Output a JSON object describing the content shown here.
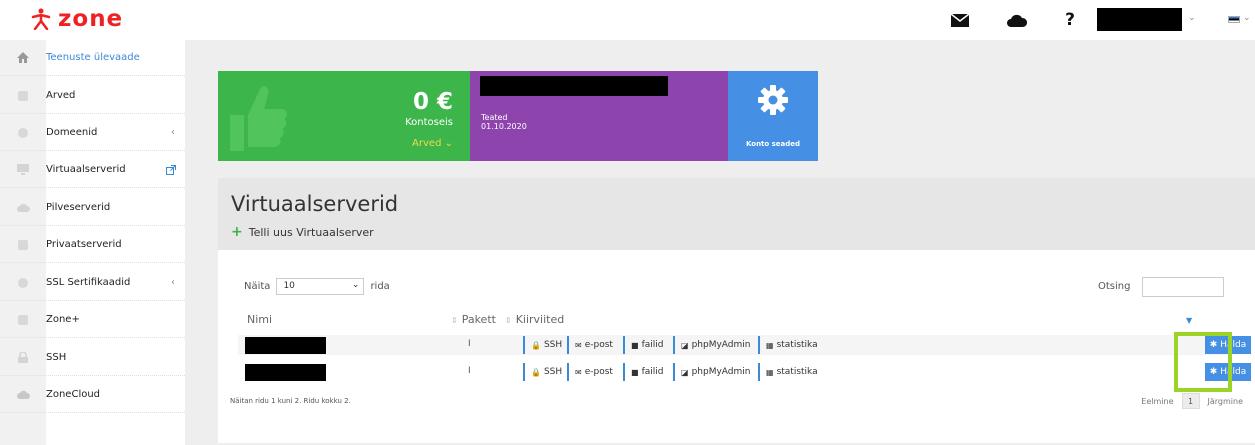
{
  "header": {
    "logo_text": "zone",
    "help_glyph": "?",
    "icons": [
      "envelope-icon",
      "cloud-icon",
      "help-icon",
      "chevron-down-icon",
      "flag-icon"
    ]
  },
  "sidebar": {
    "items": [
      {
        "label": "Teenuste ülevaade",
        "icon": "home-icon"
      },
      {
        "label": "Arved",
        "icon": "invoice-icon"
      },
      {
        "label": "Domeenid",
        "icon": "globe-icon",
        "chevron": "‹"
      },
      {
        "label": "Virtuaalserverid",
        "icon": "monitor-icon"
      },
      {
        "label": "Pilveserverid",
        "icon": "cloud-icon"
      },
      {
        "label": "Privaatserverid",
        "icon": "database-icon"
      },
      {
        "label": "SSL Sertifikaadid",
        "icon": "certificate-icon",
        "chevron": "‹"
      },
      {
        "label": "Zone+",
        "icon": "plus-square-icon"
      },
      {
        "label": "SSH",
        "icon": "lock-icon"
      },
      {
        "label": "ZoneCloud",
        "icon": "cloud-upload-icon"
      }
    ]
  },
  "tiles": {
    "balance_amount": "0 €",
    "balance_label": "Kontoseis",
    "invoices_link": "Arved",
    "notices_label": "Teated",
    "notices_date": "01.10.2020",
    "settings_label": "Konto seaded"
  },
  "page": {
    "title": "Virtuaalserverid",
    "order_link": "Telli uus Virtuaalserver"
  },
  "table": {
    "show_prefix": "Näita",
    "page_size": "10",
    "show_suffix": "rida",
    "search_label": "Otsing",
    "columns": [
      "Nimi",
      "Pakett",
      "Kiirviited"
    ],
    "rows": [
      {
        "pakett": "I",
        "links": [
          "SSH",
          "e-post",
          "failid",
          "phpMyAdmin",
          "statistika"
        ],
        "action": "Halda"
      },
      {
        "pakett": "I",
        "links": [
          "SSH",
          "e-post",
          "failid",
          "phpMyAdmin",
          "statistika"
        ],
        "action": "Halda"
      }
    ],
    "info": "Näitan ridu 1 kuni 2. Ridu kokku 2.",
    "prev": "Eelmine",
    "page": "1",
    "next": "Järgmine"
  },
  "colors": {
    "green": "#3cb54a",
    "purple": "#8e44ad",
    "blue": "#4590e4",
    "highlight": "#9bd426",
    "brand_red": "#e22222"
  }
}
